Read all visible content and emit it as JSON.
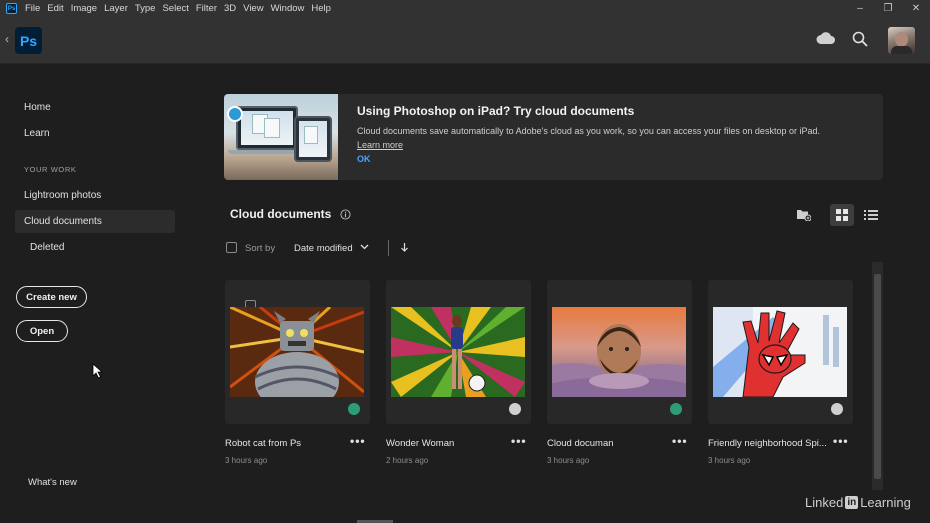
{
  "menubar": {
    "app_icon": "ps-mini-icon",
    "items": [
      "File",
      "Edit",
      "Image",
      "Layer",
      "Type",
      "Select",
      "Filter",
      "3D",
      "View",
      "Window",
      "Help"
    ],
    "window_controls": [
      "minimize",
      "restore",
      "close"
    ]
  },
  "header": {
    "logo": "Ps",
    "icons": [
      "cloud-icon",
      "search-icon",
      "avatar"
    ]
  },
  "sidebar": {
    "home": "Home",
    "learn": "Learn",
    "section": "YOUR WORK",
    "lightroom": "Lightroom photos",
    "cloud_docs": "Cloud documents",
    "deleted": "Deleted",
    "create_new": "Create new",
    "open": "Open",
    "whats_new": "What's new"
  },
  "banner": {
    "title": "Using Photoshop on iPad? Try cloud documents",
    "text": "Cloud documents save automatically to Adobe's cloud as you work, so you can access your files on desktop or iPad.",
    "learn_more": "Learn more",
    "ok": "OK"
  },
  "main": {
    "title": "Cloud documents",
    "sort_by": "Sort by",
    "sort_value": "Date modified",
    "view_mode": "grid"
  },
  "documents": [
    {
      "name": "Robot cat from Ps",
      "time": "3 hours ago",
      "status": "synced"
    },
    {
      "name": "Wonder Woman",
      "time": "2 hours ago",
      "status": "cloud"
    },
    {
      "name": "Cloud documan",
      "time": "3 hours ago",
      "status": "synced"
    },
    {
      "name": "Friendly neighborhood Spi...",
      "time": "3 hours ago",
      "status": "cloud"
    }
  ],
  "watermark": {
    "pre": "Linked",
    "in": "in",
    "post": "Learning"
  },
  "colors": {
    "accent": "#31a8ff",
    "link": "#4ba3ff",
    "synced": "#2d9d78"
  }
}
